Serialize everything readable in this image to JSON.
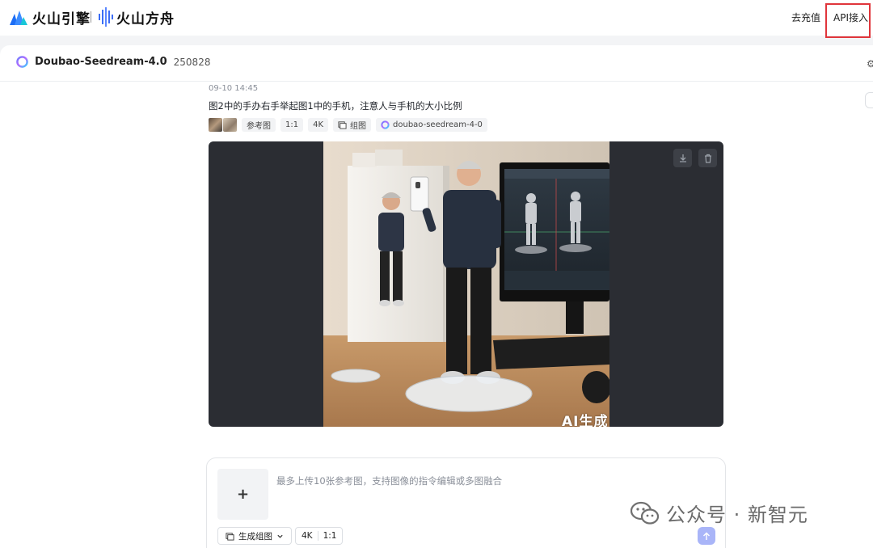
{
  "header": {
    "brand_primary": "火山引擎",
    "brand_secondary": "火山方舟",
    "recharge_label": "去充值",
    "api_label": "API接入"
  },
  "model": {
    "name": "Doubao-Seedream-4.0",
    "version": "250828"
  },
  "message": {
    "time": "09-10 14:45",
    "prompt": "图2中的手办右手举起图1中的手机，注意人与手机的大小比例",
    "tags": {
      "reference_label": "参考图",
      "ratio": "1:1",
      "resolution": "4K",
      "mode_label": "组图",
      "model_id": "doubao-seedream-4-0"
    }
  },
  "result": {
    "ai_label": "AI生成"
  },
  "composer": {
    "placeholder": "最多上传10张参考图，支持图像的指令编辑或多图融合",
    "upload_symbol": "+",
    "generate_mode_label": "生成组图",
    "resolution": "4K",
    "ratio": "1:1"
  },
  "watermark": {
    "text": "公众号 · 新智元"
  },
  "colors": {
    "highlight_border": "#e0353b",
    "send_button": "#a9b5f8",
    "card_bg": "#2b2d33"
  }
}
